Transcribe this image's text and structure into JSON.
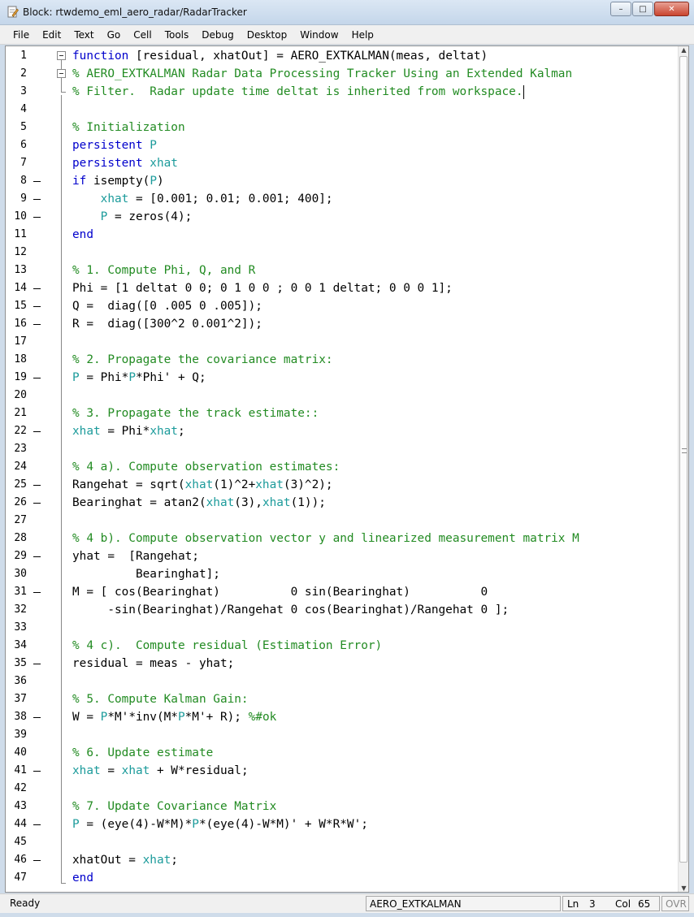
{
  "window": {
    "title": "Block: rtwdemo_eml_aero_radar/RadarTracker",
    "buttons": {
      "minimize": "–",
      "maximize": "□",
      "close": "✕"
    }
  },
  "menu": [
    "File",
    "Edit",
    "Text",
    "Go",
    "Cell",
    "Tools",
    "Debug",
    "Desktop",
    "Window",
    "Help"
  ],
  "colors": {
    "keyword": "#0000cc",
    "comment": "#228b22",
    "persistent_var": "#1c9b9b"
  },
  "code": [
    {
      "n": "1",
      "dash": false,
      "tokens": [
        {
          "t": "function",
          "c": "kw"
        },
        {
          "t": " [residual, xhatOut] = AERO_EXTKALMAN(meas, deltat)",
          "c": "tx"
        }
      ]
    },
    {
      "n": "2",
      "dash": false,
      "tokens": [
        {
          "t": "% AERO_EXTKALMAN Radar Data Processing Tracker Using an Extended Kalman",
          "c": "cm"
        }
      ]
    },
    {
      "n": "3",
      "dash": false,
      "tokens": [
        {
          "t": "% Filter.  Radar update time deltat is inherited from workspace.",
          "c": "cm"
        }
      ]
    },
    {
      "n": "4",
      "dash": false,
      "tokens": []
    },
    {
      "n": "5",
      "dash": false,
      "tokens": [
        {
          "t": "% Initialization",
          "c": "cm"
        }
      ]
    },
    {
      "n": "6",
      "dash": false,
      "tokens": [
        {
          "t": "persistent",
          "c": "kw"
        },
        {
          "t": " P",
          "c": "pv"
        }
      ]
    },
    {
      "n": "7",
      "dash": false,
      "tokens": [
        {
          "t": "persistent",
          "c": "kw"
        },
        {
          "t": " xhat",
          "c": "pv"
        }
      ]
    },
    {
      "n": "8",
      "dash": true,
      "tokens": [
        {
          "t": "if",
          "c": "kw"
        },
        {
          "t": " isempty(",
          "c": "tx"
        },
        {
          "t": "P",
          "c": "pv"
        },
        {
          "t": ")",
          "c": "tx"
        }
      ]
    },
    {
      "n": "9",
      "dash": true,
      "tokens": [
        {
          "t": "    ",
          "c": "tx"
        },
        {
          "t": "xhat",
          "c": "pv"
        },
        {
          "t": " = [0.001; 0.01; 0.001; 400];",
          "c": "tx"
        }
      ]
    },
    {
      "n": "10",
      "dash": true,
      "tokens": [
        {
          "t": "    ",
          "c": "tx"
        },
        {
          "t": "P",
          "c": "pv"
        },
        {
          "t": " = zeros(4);",
          "c": "tx"
        }
      ]
    },
    {
      "n": "11",
      "dash": false,
      "tokens": [
        {
          "t": "end",
          "c": "kw"
        }
      ]
    },
    {
      "n": "12",
      "dash": false,
      "tokens": []
    },
    {
      "n": "13",
      "dash": false,
      "tokens": [
        {
          "t": "% 1. Compute Phi, Q, and R",
          "c": "cm"
        }
      ]
    },
    {
      "n": "14",
      "dash": true,
      "tokens": [
        {
          "t": "Phi = [1 deltat 0 0; 0 1 0 0 ; 0 0 1 deltat; 0 0 0 1];",
          "c": "tx"
        }
      ]
    },
    {
      "n": "15",
      "dash": true,
      "tokens": [
        {
          "t": "Q =  diag([0 .005 0 .005]);",
          "c": "tx"
        }
      ]
    },
    {
      "n": "16",
      "dash": true,
      "tokens": [
        {
          "t": "R =  diag([300^2 0.001^2]);",
          "c": "tx"
        }
      ]
    },
    {
      "n": "17",
      "dash": false,
      "tokens": []
    },
    {
      "n": "18",
      "dash": false,
      "tokens": [
        {
          "t": "% 2. Propagate the covariance matrix:",
          "c": "cm"
        }
      ]
    },
    {
      "n": "19",
      "dash": true,
      "tokens": [
        {
          "t": "P",
          "c": "pv"
        },
        {
          "t": " = Phi*",
          "c": "tx"
        },
        {
          "t": "P",
          "c": "pv"
        },
        {
          "t": "*Phi' + Q;",
          "c": "tx"
        }
      ]
    },
    {
      "n": "20",
      "dash": false,
      "tokens": []
    },
    {
      "n": "21",
      "dash": false,
      "tokens": [
        {
          "t": "% 3. Propagate the track estimate::",
          "c": "cm"
        }
      ]
    },
    {
      "n": "22",
      "dash": true,
      "tokens": [
        {
          "t": "xhat",
          "c": "pv"
        },
        {
          "t": " = Phi*",
          "c": "tx"
        },
        {
          "t": "xhat",
          "c": "pv"
        },
        {
          "t": ";",
          "c": "tx"
        }
      ]
    },
    {
      "n": "23",
      "dash": false,
      "tokens": []
    },
    {
      "n": "24",
      "dash": false,
      "tokens": [
        {
          "t": "% 4 a). Compute observation estimates:",
          "c": "cm"
        }
      ]
    },
    {
      "n": "25",
      "dash": true,
      "tokens": [
        {
          "t": "Rangehat = sqrt(",
          "c": "tx"
        },
        {
          "t": "xhat",
          "c": "pv"
        },
        {
          "t": "(1)^2+",
          "c": "tx"
        },
        {
          "t": "xhat",
          "c": "pv"
        },
        {
          "t": "(3)^2);",
          "c": "tx"
        }
      ]
    },
    {
      "n": "26",
      "dash": true,
      "tokens": [
        {
          "t": "Bearinghat = atan2(",
          "c": "tx"
        },
        {
          "t": "xhat",
          "c": "pv"
        },
        {
          "t": "(3),",
          "c": "tx"
        },
        {
          "t": "xhat",
          "c": "pv"
        },
        {
          "t": "(1));",
          "c": "tx"
        }
      ]
    },
    {
      "n": "27",
      "dash": false,
      "tokens": []
    },
    {
      "n": "28",
      "dash": false,
      "tokens": [
        {
          "t": "% 4 b). Compute observation vector y and linearized measurement matrix M",
          "c": "cm"
        }
      ]
    },
    {
      "n": "29",
      "dash": true,
      "tokens": [
        {
          "t": "yhat =  [Rangehat;",
          "c": "tx"
        }
      ]
    },
    {
      "n": "30",
      "dash": false,
      "tokens": [
        {
          "t": "         Bearinghat];",
          "c": "tx"
        }
      ]
    },
    {
      "n": "31",
      "dash": true,
      "tokens": [
        {
          "t": "M = [ cos(Bearinghat)          0 sin(Bearinghat)          0",
          "c": "tx"
        }
      ]
    },
    {
      "n": "32",
      "dash": false,
      "tokens": [
        {
          "t": "     -sin(Bearinghat)/Rangehat 0 cos(Bearinghat)/Rangehat 0 ];",
          "c": "tx"
        }
      ]
    },
    {
      "n": "33",
      "dash": false,
      "tokens": []
    },
    {
      "n": "34",
      "dash": false,
      "tokens": [
        {
          "t": "% 4 c).  Compute residual (Estimation Error)",
          "c": "cm"
        }
      ]
    },
    {
      "n": "35",
      "dash": true,
      "tokens": [
        {
          "t": "residual = meas - yhat;",
          "c": "tx"
        }
      ]
    },
    {
      "n": "36",
      "dash": false,
      "tokens": []
    },
    {
      "n": "37",
      "dash": false,
      "tokens": [
        {
          "t": "% 5. Compute Kalman Gain:",
          "c": "cm"
        }
      ]
    },
    {
      "n": "38",
      "dash": true,
      "tokens": [
        {
          "t": "W = ",
          "c": "tx"
        },
        {
          "t": "P",
          "c": "pv"
        },
        {
          "t": "*M'*inv(M*",
          "c": "tx"
        },
        {
          "t": "P",
          "c": "pv"
        },
        {
          "t": "*M'+ R); ",
          "c": "tx"
        },
        {
          "t": "%#ok",
          "c": "cm"
        }
      ]
    },
    {
      "n": "39",
      "dash": false,
      "tokens": []
    },
    {
      "n": "40",
      "dash": false,
      "tokens": [
        {
          "t": "% 6. Update estimate",
          "c": "cm"
        }
      ]
    },
    {
      "n": "41",
      "dash": true,
      "tokens": [
        {
          "t": "xhat",
          "c": "pv"
        },
        {
          "t": " = ",
          "c": "tx"
        },
        {
          "t": "xhat",
          "c": "pv"
        },
        {
          "t": " + W*residual;",
          "c": "tx"
        }
      ]
    },
    {
      "n": "42",
      "dash": false,
      "tokens": []
    },
    {
      "n": "43",
      "dash": false,
      "tokens": [
        {
          "t": "% 7. Update Covariance Matrix",
          "c": "cm"
        }
      ]
    },
    {
      "n": "44",
      "dash": true,
      "tokens": [
        {
          "t": "P",
          "c": "pv"
        },
        {
          "t": " = (eye(4)-W*M)*",
          "c": "tx"
        },
        {
          "t": "P",
          "c": "pv"
        },
        {
          "t": "*(eye(4)-W*M)' + W*R*W';",
          "c": "tx"
        }
      ]
    },
    {
      "n": "45",
      "dash": false,
      "tokens": []
    },
    {
      "n": "46",
      "dash": true,
      "tokens": [
        {
          "t": "xhatOut = ",
          "c": "tx"
        },
        {
          "t": "xhat",
          "c": "pv"
        },
        {
          "t": ";",
          "c": "tx"
        }
      ]
    },
    {
      "n": "47",
      "dash": false,
      "tokens": [
        {
          "t": "end",
          "c": "kw"
        }
      ]
    }
  ],
  "status": {
    "ready": "Ready",
    "function_name": "AERO_EXTKALMAN",
    "ln_label": "Ln",
    "ln_value": "3",
    "col_label": "Col",
    "col_value": "65",
    "ovr": "OVR"
  }
}
